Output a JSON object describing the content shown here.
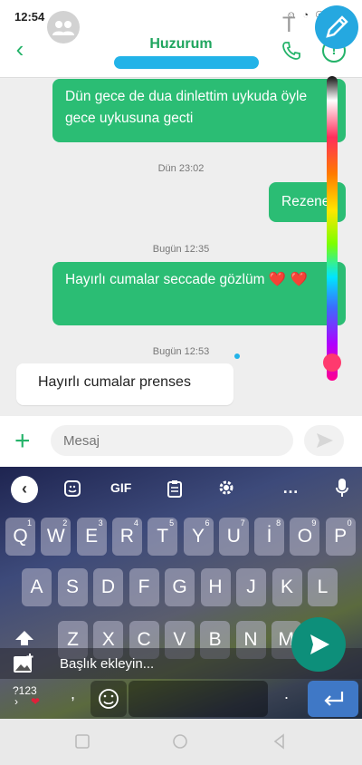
{
  "status": {
    "time": "12:54",
    "icons": "☺ ◔ ☉"
  },
  "header": {
    "contact_name": "Huzurum"
  },
  "messages": [
    {
      "type": "out",
      "text": "Dün gece de dua dinlettim uykuda öyle gece uykusuna gecti"
    },
    {
      "type": "timestamp",
      "text": "Dün 23:02"
    },
    {
      "type": "out",
      "text": "Rezene"
    },
    {
      "type": "timestamp",
      "text": "Bugün 12:35"
    },
    {
      "type": "out",
      "text": "Hayırlı cumalar seccade gözlüm ❤️ ❤️"
    },
    {
      "type": "timestamp",
      "text": "Bugün 12:53"
    },
    {
      "type": "in",
      "text": "Hayırlı cumalar prenses"
    }
  ],
  "composer": {
    "placeholder": "Mesaj"
  },
  "keyboard": {
    "toolbar": {
      "gif": "GIF"
    },
    "rows": [
      [
        {
          "k": "Q",
          "h": "1"
        },
        {
          "k": "W",
          "h": "2"
        },
        {
          "k": "E",
          "h": "3"
        },
        {
          "k": "R",
          "h": "4"
        },
        {
          "k": "T",
          "h": "5"
        },
        {
          "k": "Y",
          "h": "6"
        },
        {
          "k": "U",
          "h": "7"
        },
        {
          "k": "İ",
          "h": "8"
        },
        {
          "k": "O",
          "h": "9"
        },
        {
          "k": "P",
          "h": "0"
        }
      ],
      [
        {
          "k": "A"
        },
        {
          "k": "S"
        },
        {
          "k": "D"
        },
        {
          "k": "F"
        },
        {
          "k": "G"
        },
        {
          "k": "H"
        },
        {
          "k": "J"
        },
        {
          "k": "K"
        },
        {
          "k": "L"
        }
      ],
      [
        {
          "k": "Z"
        },
        {
          "k": "X"
        },
        {
          "k": "C"
        },
        {
          "k": "V"
        },
        {
          "k": "B"
        },
        {
          "k": "N"
        },
        {
          "k": "M"
        }
      ]
    ],
    "caption_placeholder": "Başlık ekleyin...",
    "key_123": "?123",
    "comma": ",",
    "period": "."
  },
  "colors": {
    "accent": "#2bbd74",
    "header_name": "#1fa55e",
    "overlay_pen": "#25a8e0",
    "fab": "#0d8f7a"
  }
}
